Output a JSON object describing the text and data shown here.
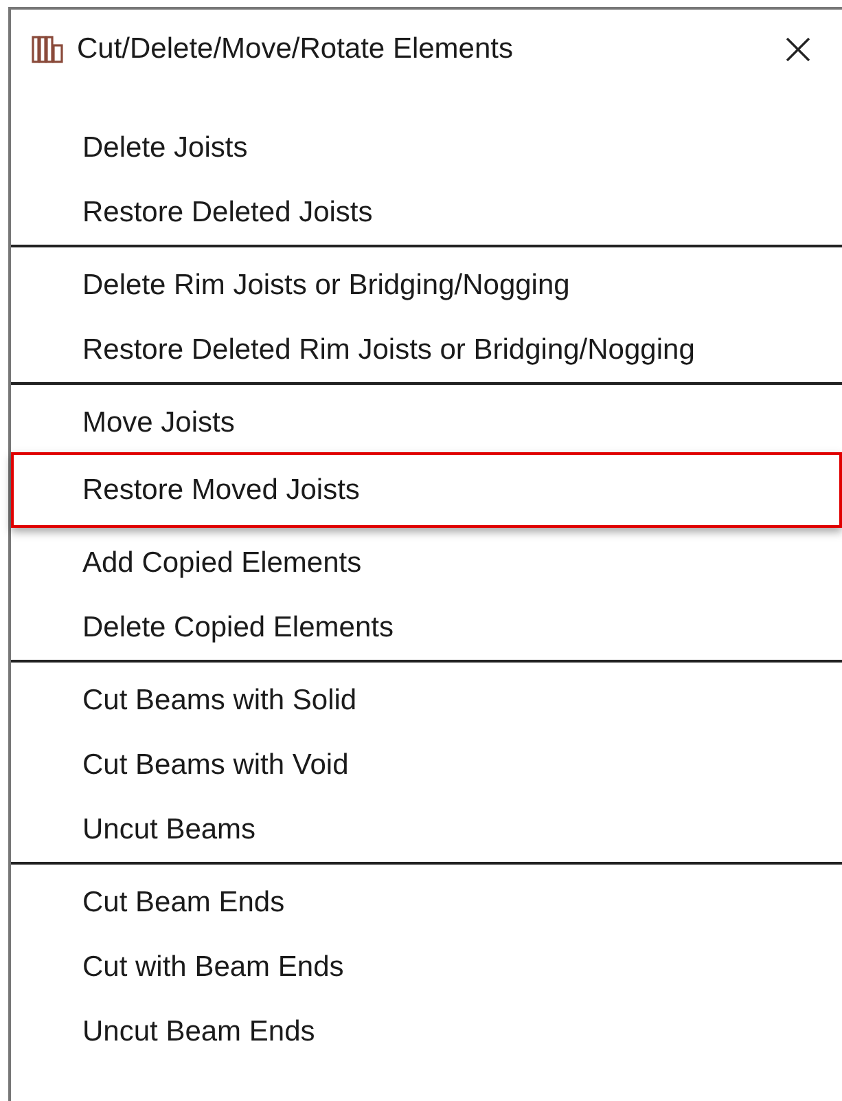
{
  "window": {
    "title": "Cut/Delete/Move/Rotate Elements"
  },
  "groups": [
    {
      "items": [
        {
          "label": "Delete Joists",
          "selected": false
        },
        {
          "label": "Restore Deleted Joists",
          "selected": false
        }
      ]
    },
    {
      "items": [
        {
          "label": "Delete Rim Joists or Bridging/Nogging",
          "selected": false
        },
        {
          "label": "Restore Deleted Rim Joists or Bridging/Nogging",
          "selected": false
        }
      ]
    },
    {
      "items": [
        {
          "label": "Move Joists",
          "selected": false
        },
        {
          "label": "Restore Moved Joists",
          "selected": true
        },
        {
          "label": "Add Copied Elements",
          "selected": false
        },
        {
          "label": "Delete Copied Elements",
          "selected": false
        }
      ]
    },
    {
      "items": [
        {
          "label": "Cut Beams with Solid",
          "selected": false
        },
        {
          "label": "Cut Beams with Void",
          "selected": false
        },
        {
          "label": "Uncut Beams",
          "selected": false
        }
      ]
    },
    {
      "items": [
        {
          "label": "Cut Beam Ends",
          "selected": false
        },
        {
          "label": "Cut with Beam Ends",
          "selected": false
        },
        {
          "label": "Uncut Beam Ends",
          "selected": false
        }
      ]
    }
  ]
}
